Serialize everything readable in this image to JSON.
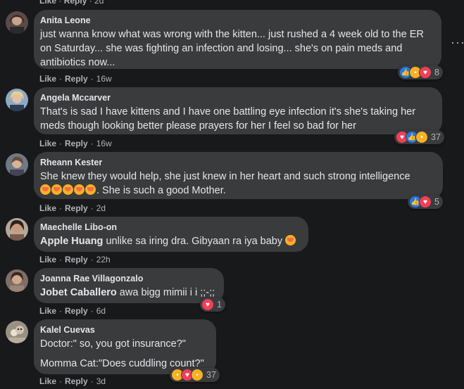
{
  "top_meta": {
    "like": "Like",
    "reply": "Reply",
    "time": "2d"
  },
  "comments": [
    {
      "author": "Anita Leone",
      "text": "just wanna know what was wrong with the kitten... just rushed a 4 week old to the ER on Saturday... she was fighting an infection and losing... she's on pain meds and antibiotics now...",
      "like": "Like",
      "reply": "Reply",
      "time": "16w",
      "reaction_count": "8",
      "reaction_icons": [
        "like-icon",
        "sad-icon",
        "love-icon"
      ]
    },
    {
      "author": "Angela Mccarver",
      "text": "That's is sad I have kittens and I have one battling eye infection it's she's taking her meds though looking better please prayers for her I feel so bad for her",
      "like": "Like",
      "reply": "Reply",
      "time": "16w",
      "reaction_count": "37",
      "reaction_icons": [
        "love-icon",
        "like-icon",
        "care-icon"
      ]
    },
    {
      "author": "Rheann Kester",
      "text": "She knew they would help, she just knew in her heart and such strong intelligence",
      "text2": ". She is such a good Mother.",
      "like": "Like",
      "reply": "Reply",
      "time": "2d",
      "reaction_count": "5",
      "reaction_icons": [
        "like-icon",
        "love-icon"
      ],
      "emoji_count": 5
    },
    {
      "author": "Maechelle Libo-on",
      "mention": "Apple Huang",
      "text": " unlike sa iring dra. Gibyaan ra iya baby",
      "like": "Like",
      "reply": "Reply",
      "time": "22h"
    },
    {
      "author": "Joanna Rae Villagonzalo",
      "mention": "Jobet Caballero",
      "text": " awa bigg mimii i i ;;-;;",
      "like": "Like",
      "reply": "Reply",
      "time": "6d",
      "reaction_count": "1",
      "reaction_icons": [
        "love-icon"
      ]
    },
    {
      "author": "Kalel Cuevas",
      "line1": "Doctor:\" so, you got insurance?\"",
      "line2": "Momma Cat:\"Does cuddling count?\"",
      "like": "Like",
      "reply": "Reply",
      "time": "3d",
      "reaction_count": "37",
      "reaction_icons": [
        "haha-icon",
        "love-icon",
        "care-icon"
      ]
    }
  ],
  "colors": {
    "background": "#18191a",
    "bubble": "#3a3b3c",
    "text": "#e4e6eb",
    "muted": "#b0b3b8",
    "like_blue": "#2078f4",
    "love_red": "#f33e58",
    "emoji_yellow": "#f7b125"
  }
}
